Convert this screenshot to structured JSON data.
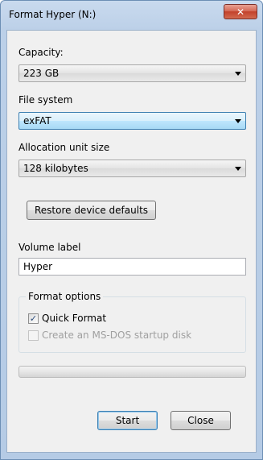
{
  "window": {
    "title": "Format Hyper (N:)",
    "close_glyph": "✕"
  },
  "capacity": {
    "label": "Capacity:",
    "value": "223 GB"
  },
  "file_system": {
    "label": "File system",
    "value": "exFAT"
  },
  "allocation": {
    "label": "Allocation unit size",
    "value": "128 kilobytes"
  },
  "restore_button": {
    "label": "Restore device defaults"
  },
  "volume": {
    "label": "Volume label",
    "value": "Hyper"
  },
  "format_options": {
    "legend": "Format options",
    "quick_format": {
      "label": "Quick Format",
      "checked": true,
      "check_glyph": "✓"
    },
    "msdos_disk": {
      "label": "Create an MS-DOS startup disk",
      "checked": false,
      "enabled": false
    }
  },
  "progress": {
    "value_percent": 0
  },
  "buttons": {
    "start": "Start",
    "close": "Close"
  },
  "icons": {
    "close": "close-icon",
    "dropdown": "chevron-down-icon",
    "check": "check-icon"
  },
  "colors": {
    "title_gradient_top": "#c9daee",
    "close_button": "#c2412b",
    "focus_accent": "#3c7fb1",
    "progress_fill": "#37b24a"
  }
}
